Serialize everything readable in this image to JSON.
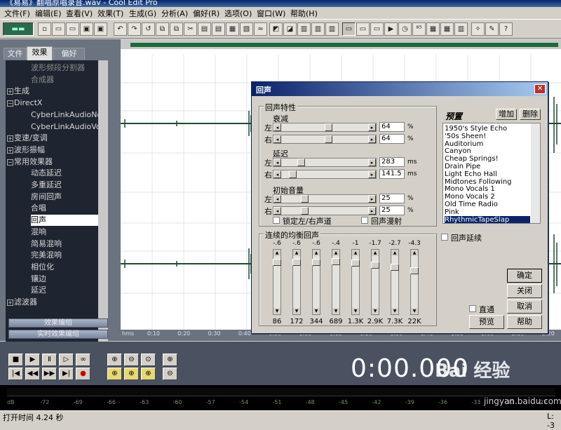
{
  "window": {
    "title": "《易易》翻唱原唱录音.wav - Cool Edit Pro"
  },
  "menu": [
    "文件(F)",
    "编辑(E)",
    "查看(V)",
    "效果(T)",
    "生成(G)",
    "分析(A)",
    "偏好(R)",
    "选项(O)",
    "窗口(W)",
    "帮助(H)"
  ],
  "left_panel": {
    "tabs": [
      "文件",
      "效果",
      "偏好"
    ],
    "tree": [
      {
        "label": "波形频段分割器",
        "indent": 2,
        "dim": true
      },
      {
        "label": "合成器",
        "indent": 2,
        "dim": true
      },
      {
        "label": "生成",
        "indent": 1,
        "expander": "+"
      },
      {
        "label": "DirectX",
        "indent": 1,
        "expander": "-"
      },
      {
        "label": "CyberLinkAudioNo",
        "indent": 2
      },
      {
        "label": "CyberLinkAudioVol",
        "indent": 2
      },
      {
        "label": "变速/变调",
        "indent": 1,
        "expander": "+"
      },
      {
        "label": "波形振幅",
        "indent": 1,
        "expander": "+"
      },
      {
        "label": "常用效果器",
        "indent": 1,
        "expander": "-"
      },
      {
        "label": "动态延迟",
        "indent": 2
      },
      {
        "label": "多重延迟",
        "indent": 2
      },
      {
        "label": "房间回声",
        "indent": 2
      },
      {
        "label": "合唱",
        "indent": 2
      },
      {
        "label": "回声",
        "indent": 2,
        "selected": true
      },
      {
        "label": "混响",
        "indent": 2
      },
      {
        "label": "简易混响",
        "indent": 2
      },
      {
        "label": "完美混响",
        "indent": 2
      },
      {
        "label": "相位化",
        "indent": 2
      },
      {
        "label": "镶边",
        "indent": 2
      },
      {
        "label": "延迟",
        "indent": 2
      },
      {
        "label": "滤波器",
        "indent": 1,
        "expander": "+"
      }
    ],
    "buttons": [
      "效果编组",
      "实时效果编组"
    ]
  },
  "ruler": [
    "hms",
    "0:10",
    "0:20",
    "0:30",
    "0:40",
    "0:50",
    "1:00",
    "1:10",
    "1:20",
    "1:30",
    "1:40",
    "1:50",
    "2:00",
    "2:10",
    "2:20"
  ],
  "transport": {
    "time": "0:00.000"
  },
  "meter": {
    "ticks": [
      "dB",
      "-72",
      "-69",
      "-66",
      "-63",
      "-60",
      "-57",
      "-54",
      "-51",
      "-48",
      "-45",
      "-42",
      "-39",
      "-36",
      "-33",
      "-30",
      "-27"
    ]
  },
  "status": {
    "left": "打开时间 4.24 秒",
    "right": "L: -3"
  },
  "watermark": {
    "text": "Bai 经验",
    "url": "jingyan.baidu.com"
  },
  "dialog": {
    "title": "回声",
    "echo_group": "回声特性",
    "decay": {
      "label": "衰减",
      "left_label": "左",
      "right_label": "右",
      "left_value": "64",
      "right_value": "64",
      "unit": "%",
      "left_pos": 0.55,
      "right_pos": 0.55
    },
    "delay": {
      "label": "延迟",
      "left_label": "左",
      "right_label": "右",
      "left_value": "283",
      "right_value": "141.5",
      "unit": "ms",
      "left_pos": 0.2,
      "right_pos": 0.1
    },
    "initial": {
      "label": "初始音量",
      "left_label": "左",
      "right_label": "右",
      "left_value": "25",
      "right_value": "25",
      "unit": "%",
      "left_pos": 0.25,
      "right_pos": 0.25
    },
    "lock_lr": "锁定左/右声道",
    "echo_bounce": "回声漫射",
    "eq_group": "连续的均衡回声",
    "eq": [
      {
        "value": "-.6",
        "freq": "86",
        "pos": 0.04
      },
      {
        "value": "-.6",
        "freq": "172",
        "pos": 0.04
      },
      {
        "value": "-.6",
        "freq": "344",
        "pos": 0.04
      },
      {
        "value": "-.4",
        "freq": "689",
        "pos": 0.03
      },
      {
        "value": "-1",
        "freq": "1.3K",
        "pos": 0.06
      },
      {
        "value": "-1.7",
        "freq": "2.9K",
        "pos": 0.09
      },
      {
        "value": "-2.7",
        "freq": "7.3K",
        "pos": 0.13
      },
      {
        "value": "-4.3",
        "freq": "22K",
        "pos": 0.2
      }
    ],
    "presets_label": "预置",
    "add": "增加",
    "delete": "删除",
    "presets": [
      "1950's Style Echo",
      "'50s Sheen!",
      "Auditorium",
      "Canyon",
      "Cheap Springs!",
      "Drain Pipe",
      "Light Echo Hall",
      "Midtones Following",
      "Mono Vocals 1",
      "Mono Vocals 2",
      "Old Time Radio",
      "Pink",
      "RhythmicTapeSlap"
    ],
    "selected_preset": "RhythmicTapeSlap",
    "echo_continue": "回声延续",
    "bypass": "直通",
    "ok": "确定",
    "close": "关闭",
    "cancel": "取消",
    "preview": "预览",
    "help": "帮助"
  }
}
